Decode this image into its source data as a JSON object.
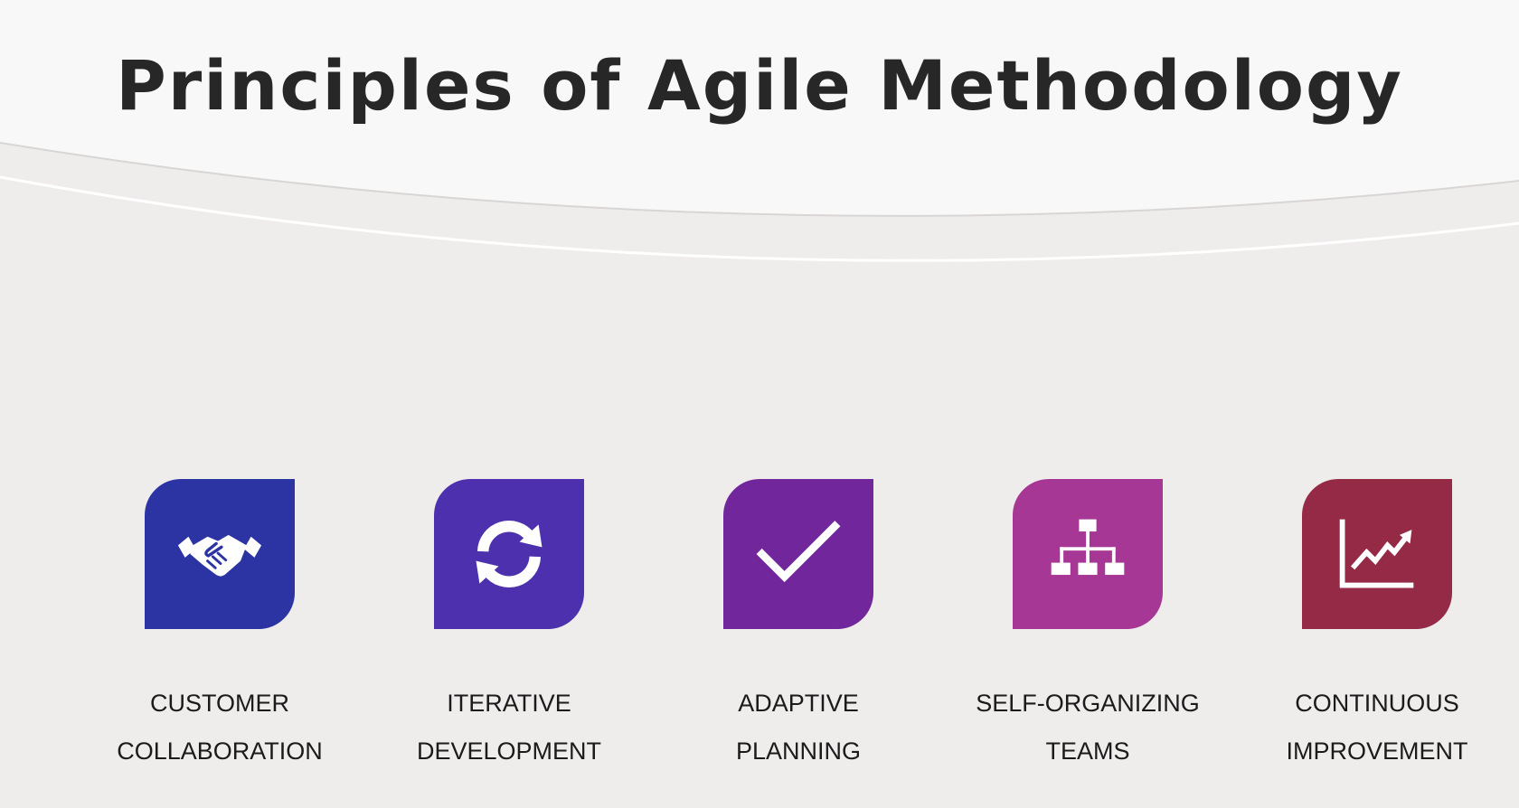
{
  "slide": {
    "title": "Principles of Agile Methodology",
    "background_color": "#efedec",
    "header_color": "#f8f8f8",
    "title_color": "#272727"
  },
  "principles": [
    {
      "icon": "handshake-icon",
      "color": "#2c33a2",
      "line1": "CUSTOMER",
      "line2": "COLLABORATION"
    },
    {
      "icon": "refresh-icon",
      "color": "#4d30ad",
      "line1": "ITERATIVE",
      "line2": "DEVELOPMENT"
    },
    {
      "icon": "checkmark-icon",
      "color": "#71279b",
      "line1": "ADAPTIVE",
      "line2": "PLANNING"
    },
    {
      "icon": "org-chart-icon",
      "color": "#a73795",
      "line1": "SELF-ORGANIZING",
      "line2": "TEAMS"
    },
    {
      "icon": "line-chart-icon",
      "color": "#942a46",
      "line1": "CONTINUOUS",
      "line2": "IMPROVEMENT"
    }
  ]
}
